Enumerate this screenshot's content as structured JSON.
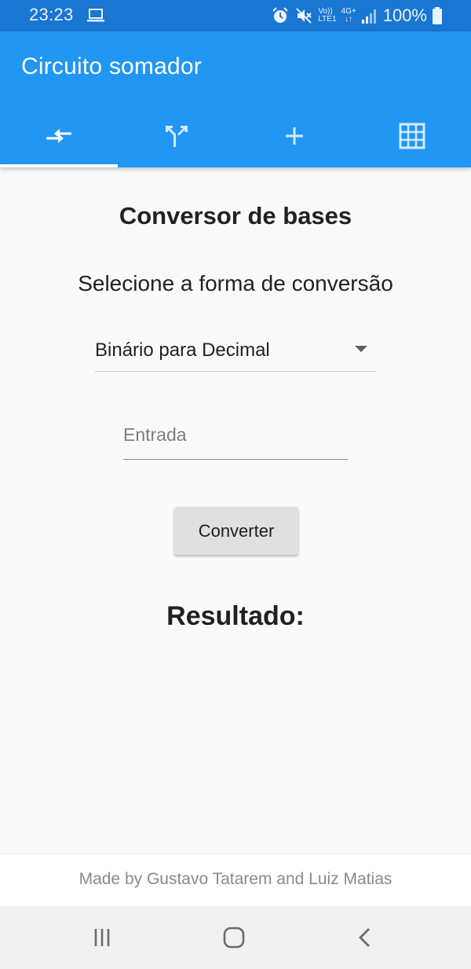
{
  "status_bar": {
    "time": "23:23",
    "battery_percent": "100%",
    "icons": [
      "laptop-icon",
      "alarm-icon",
      "mute-icon",
      "volte-icon",
      "4g-icon",
      "signal-icon",
      "battery-icon"
    ],
    "network_label_top": "Vo))",
    "network_label_bottom": "LTE1",
    "data_label": "4G+"
  },
  "app_bar": {
    "title": "Circuito somador",
    "color": "#2196f3",
    "tabs": [
      {
        "icon": "compare-arrows-icon",
        "selected": true
      },
      {
        "icon": "merge-type-icon",
        "selected": false
      },
      {
        "icon": "add-icon",
        "selected": false
      },
      {
        "icon": "grid-table-icon",
        "selected": false
      }
    ]
  },
  "main": {
    "heading": "Conversor de bases",
    "prompt": "Selecione a forma de conversão",
    "dropdown": {
      "selected": "Binário para Decimal"
    },
    "input": {
      "placeholder": "Entrada",
      "value": ""
    },
    "convert_button": "Converter",
    "result_label": "Resultado:"
  },
  "footer": {
    "credit": "Made by Gustavo Tatarem and Luiz Matias"
  },
  "nav_bar": {
    "buttons": [
      "recent-apps-icon",
      "home-icon",
      "back-icon"
    ]
  }
}
